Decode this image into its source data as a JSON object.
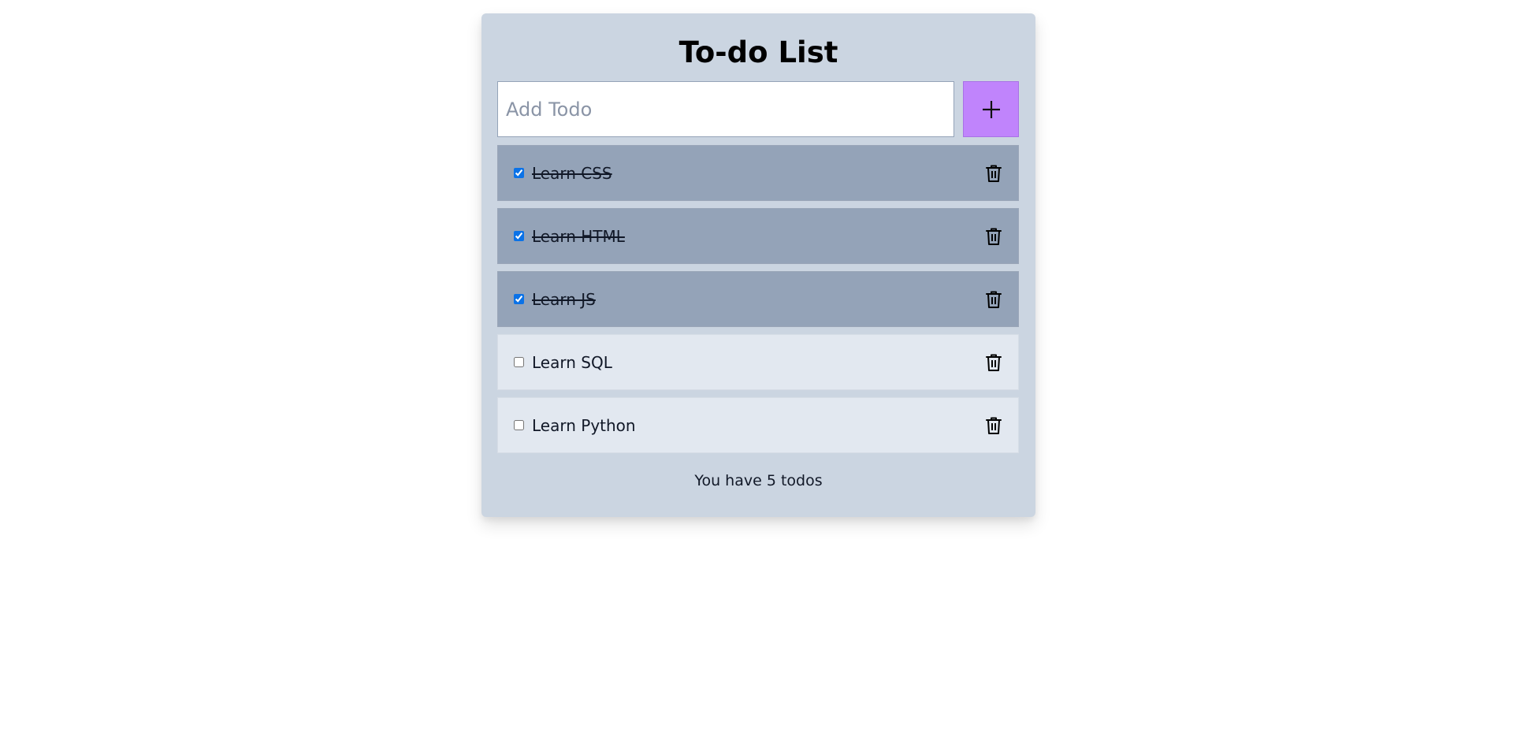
{
  "app": {
    "title": "To-do List"
  },
  "add": {
    "placeholder": "Add Todo",
    "value": "",
    "button_icon": "plus-icon"
  },
  "todos": [
    {
      "label": "Learn CSS",
      "done": true,
      "delete_icon": "trash-icon"
    },
    {
      "label": "Learn HTML",
      "done": true,
      "delete_icon": "trash-icon"
    },
    {
      "label": "Learn JS",
      "done": true,
      "delete_icon": "trash-icon"
    },
    {
      "label": "Learn SQL",
      "done": false,
      "delete_icon": "trash-icon"
    },
    {
      "label": "Learn Python",
      "done": false,
      "delete_icon": "trash-icon"
    }
  ],
  "footer": {
    "count_text": "You have 5 todos"
  },
  "colors": {
    "page_background": "#ffffff",
    "card_background": "#cbd5e1",
    "completed_item_background": "#94a3b8",
    "pending_item_background": "#e2e8f0",
    "add_button_background": "#c084fc",
    "checkbox_accent": "#0b72e7"
  }
}
